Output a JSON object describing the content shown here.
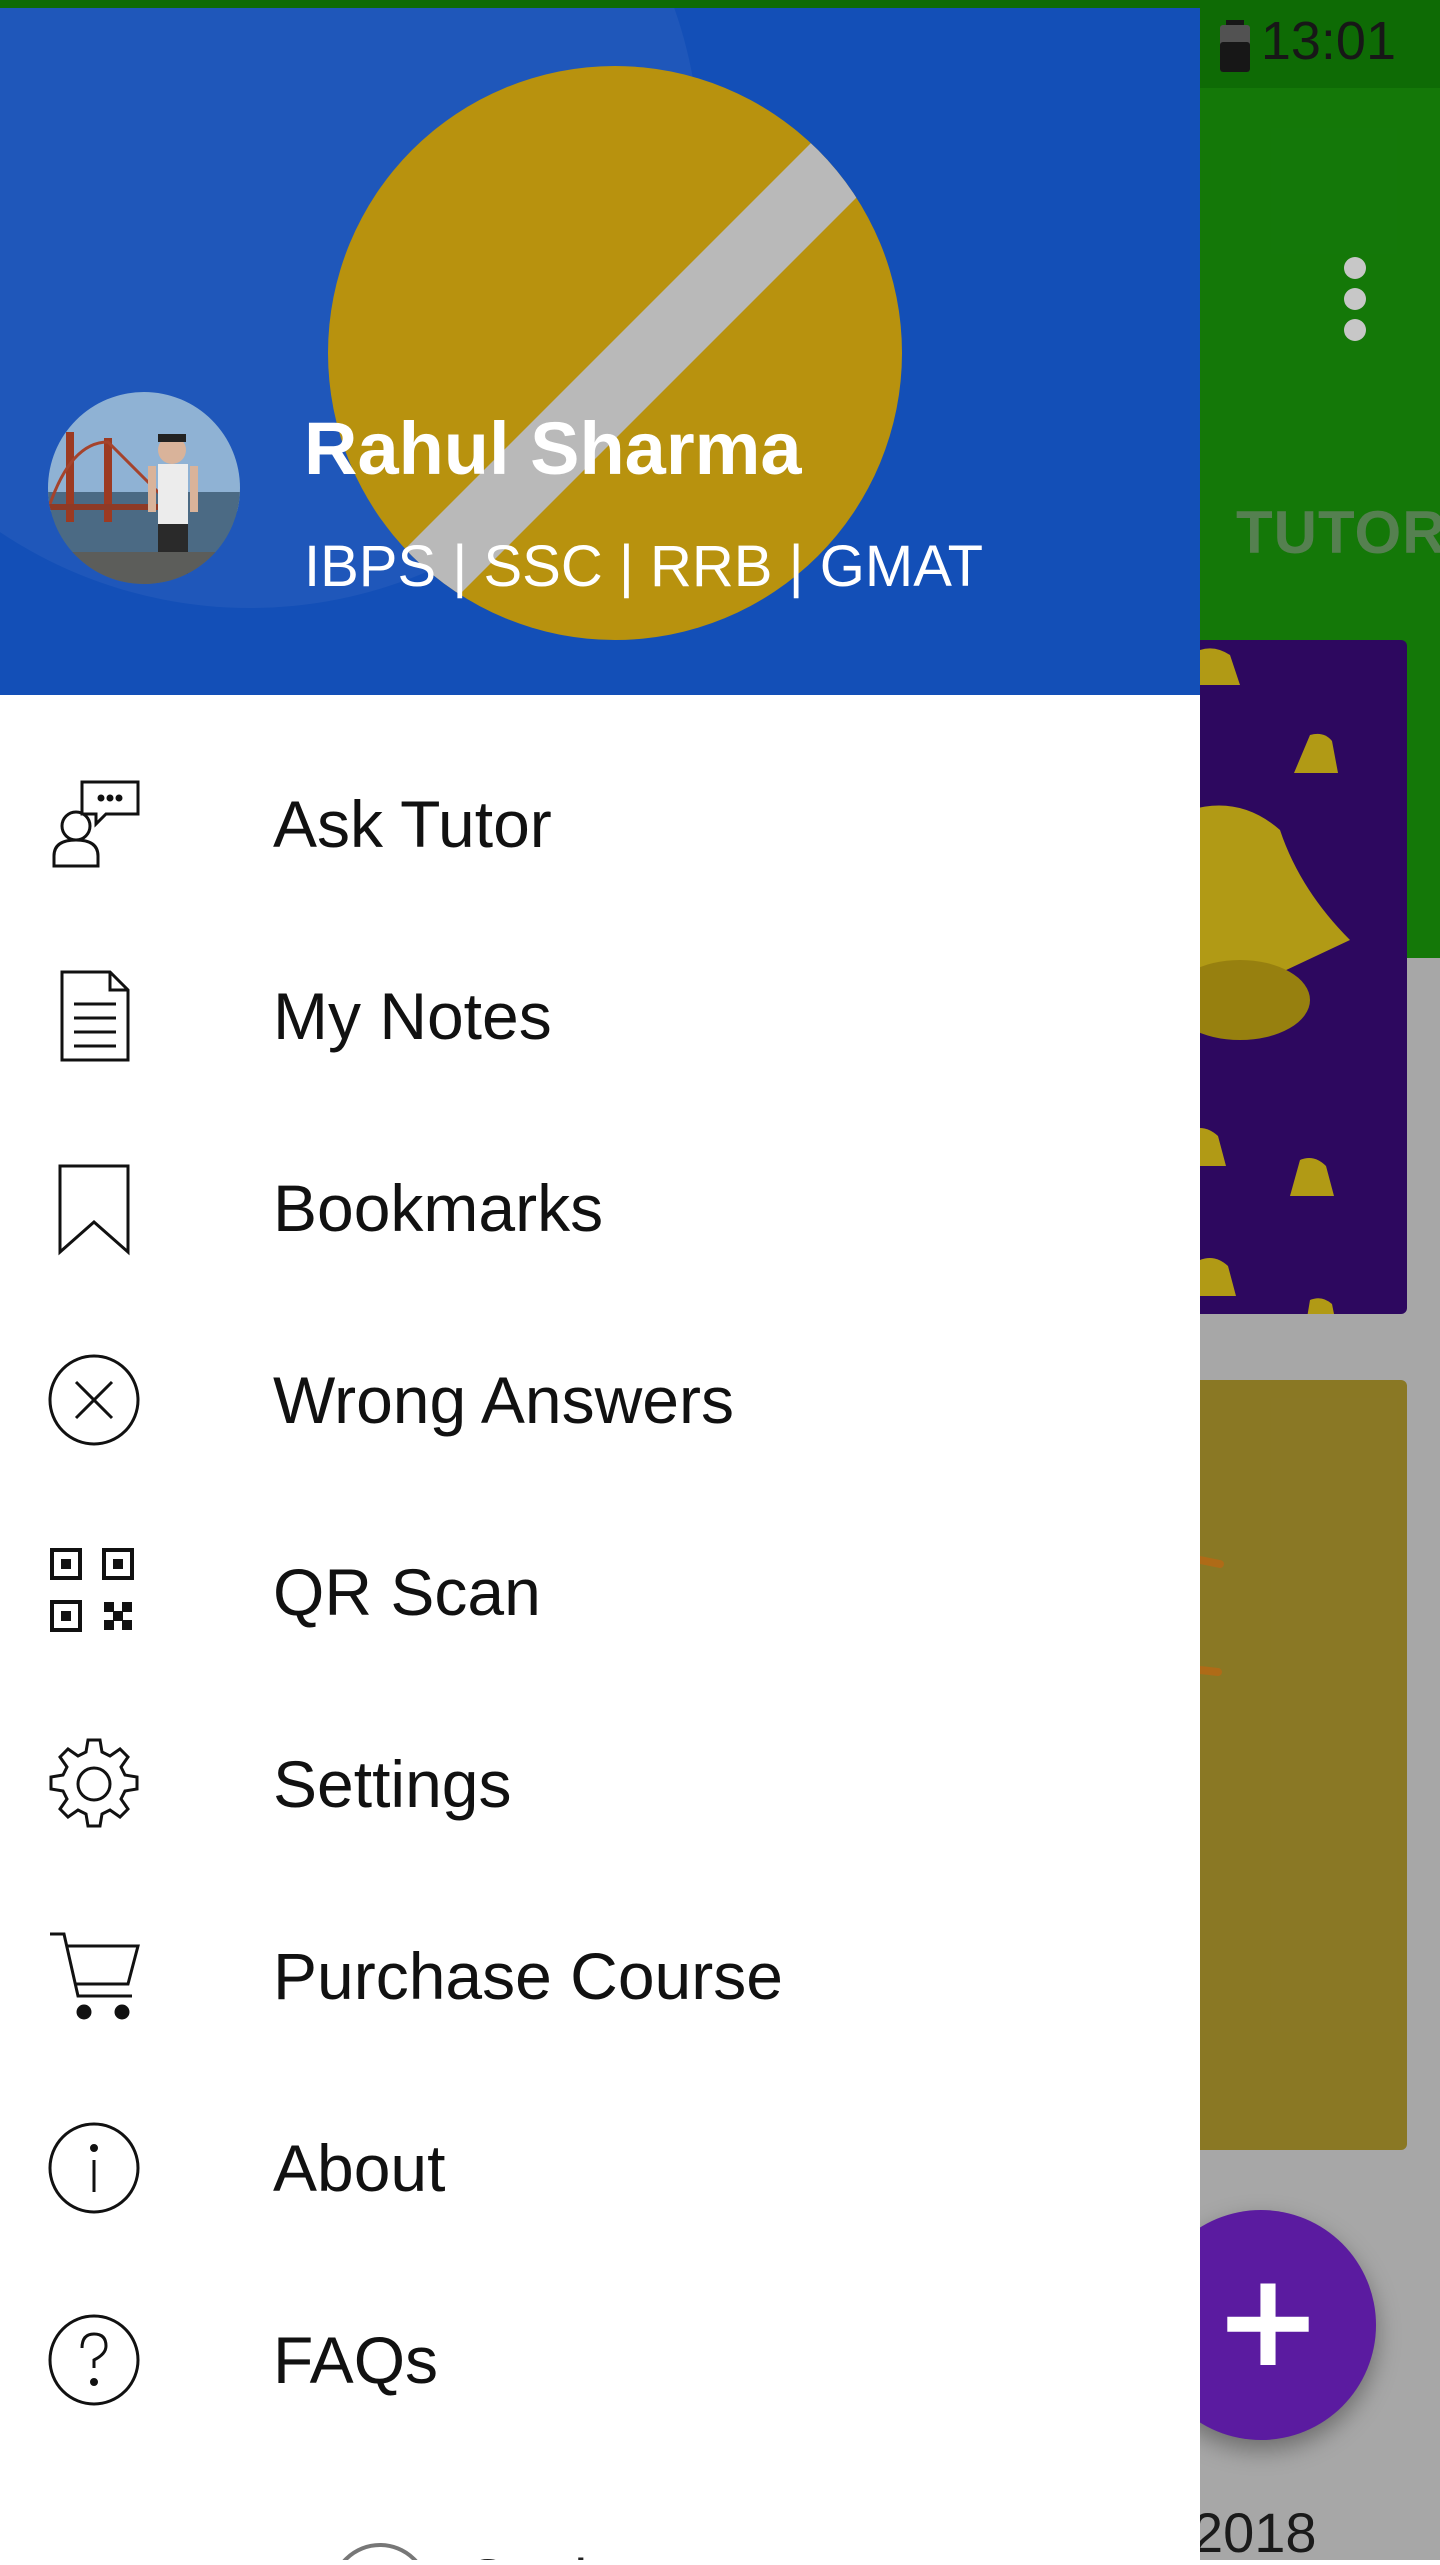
{
  "status_bar": {
    "time": "13:01"
  },
  "background": {
    "tab_label": "TUTOR",
    "date_fragment": "2018",
    "fab_label": "+"
  },
  "drawer": {
    "user": {
      "name": "Rahul Sharma",
      "exams": "IBPS | SSC | RRB | GMAT"
    },
    "menu": [
      {
        "label": "Ask Tutor",
        "icon": "ask-tutor-icon"
      },
      {
        "label": "My Notes",
        "icon": "notes-icon"
      },
      {
        "label": "Bookmarks",
        "icon": "bookmark-icon"
      },
      {
        "label": "Wrong Answers",
        "icon": "close-circle-icon"
      },
      {
        "label": "QR Scan",
        "icon": "qr-code-icon"
      },
      {
        "label": "Settings",
        "icon": "gear-icon"
      },
      {
        "label": "Purchase Course",
        "icon": "cart-icon"
      },
      {
        "label": "About",
        "icon": "info-icon"
      },
      {
        "label": "FAQs",
        "icon": "help-icon"
      }
    ],
    "footer_partial": "Studymate"
  },
  "colors": {
    "drawer_header": "#134fb7",
    "logo_yellow": "#b8920e",
    "toolbar_green": "#1a9a0b",
    "fab_purple": "#5b1ba0"
  }
}
